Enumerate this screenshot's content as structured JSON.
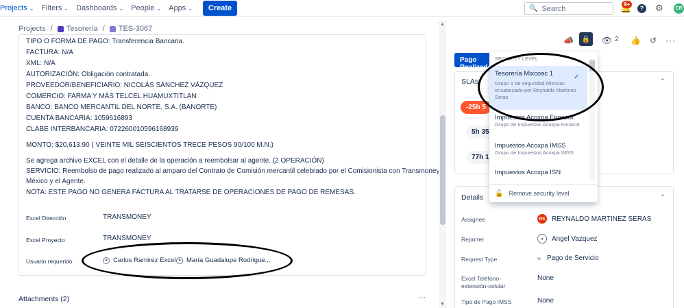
{
  "topnav": {
    "items": [
      {
        "label": "Projects",
        "active": true
      },
      {
        "label": "Filters"
      },
      {
        "label": "Dashboards"
      },
      {
        "label": "People"
      },
      {
        "label": "Apps"
      }
    ],
    "create_label": "Create",
    "search_placeholder": "Search",
    "notif_badge": "9+",
    "avatar_initials": "CR"
  },
  "breadcrumb": {
    "projects": "Projects",
    "project": "Tesorería",
    "issue": "TES-3067"
  },
  "description": {
    "lines": [
      "TIPO O FORMA DE PAGO: Transferencia Bancaria.",
      "FACTURA: N/A",
      "XML: N/A",
      "AUTORIZACIÓN: Obligación contratada.",
      "PROVEEDOR/BENEFICIARIO: NICOLÁS SÁNCHEZ VÁZQUEZ",
      "COMERCIO: FARMA Y MÁS TELCEL HUAMUXTITLAN",
      "BANCO: BANCO MERCANTIL DEL NORTE, S.A. (BANORTE)",
      "CUENTA BANCARIA: 1059616893",
      "CLABE INTERBANCARIA: 072260010596168939"
    ],
    "monto": "MONTO: $20,613.90 ( VEINTE MIL SEISCIENTOS TRECE PESOS 90/100 M.N.)",
    "extra_lines": [
      "Se agrega archivo EXCEL con el detalle de la operación a reembolsar al agente. (2 OPERACIÓN)",
      "SERVICIO: Reembolso de pago realizado al amparo del Contrato de Comisión mercantil celebrado por el Comisionista con Transmoney",
      "México y el Agente.",
      "NOTA: ESTE PAGO NO GENERA FACTURA AL TRATARSE DE OPERACIONES DE PAGO DE REMESAS."
    ]
  },
  "fields": {
    "excel_direccion_label": "Excel Dirección",
    "excel_direccion_value": "TRANSMONEY",
    "excel_proyecto_label": "Excel Proyecto",
    "excel_proyecto_value": "TRANSMONEY",
    "usuario_label": "Usuario requerido",
    "usuario_1": "Carlos Ramirez Excel",
    "usuario_2": "María Guadalupe Rodrigue..."
  },
  "attachments": {
    "label": "Attachments (2)",
    "more": "···"
  },
  "right": {
    "watch_count": "2",
    "status_label": "Pago Realizado",
    "sla_title": "SLAs",
    "sla_pills": [
      "-25h 5",
      "5h 35",
      "77h 1"
    ],
    "details_title": "Details",
    "details": [
      {
        "label": "Assignee",
        "value": "REYNALDO MARTINEZ SERAS",
        "avatar": "RS"
      },
      {
        "label": "Reporter",
        "value": "Angel Vazquez"
      },
      {
        "label": "Request Type",
        "value": "Pago de Servicio"
      },
      {
        "label": "Excel Teléfono-extensión-celular",
        "value": "None"
      },
      {
        "label": "Tipo de Pago IMSS",
        "value": "None"
      }
    ]
  },
  "security_dropdown": {
    "header": "SECURITY LEVEL",
    "items": [
      {
        "title": "Tesorería Mixcoac 1",
        "subtitle": "Grupo 1 de seguridad Mixcoac encabezado por Reynaldo Martines Seras",
        "selected": true
      },
      {
        "title": "Impuestos Acoxpa Fonacot",
        "subtitle": "Grupo de Impuestos Acoxpa Fonacot"
      },
      {
        "title": "Impuestos Acoxpa IMSS",
        "subtitle": "Grupo de Impuestos Acoxpa IMSS"
      },
      {
        "title": "Impuestos Acoxpa ISN",
        "subtitle": ""
      }
    ],
    "remove_label": "Remove security level"
  }
}
